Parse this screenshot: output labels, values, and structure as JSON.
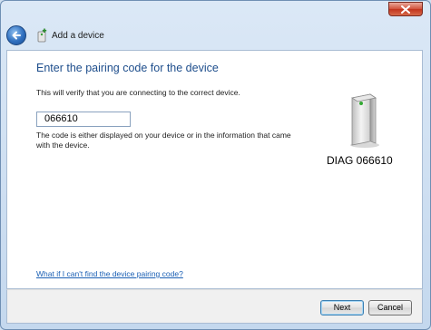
{
  "window": {
    "title": "Add a device",
    "close_icon": "close-icon"
  },
  "content": {
    "heading": "Enter the pairing code for the device",
    "subtext": "This will verify that you are connecting to the correct device.",
    "code_value": "066610",
    "help_text": "The code is either displayed on your device or in the information that came with the device.",
    "device_name": "DIAG 066610",
    "device_icon": "device-tower-icon",
    "help_link": "What if I can't find the device pairing code?"
  },
  "footer": {
    "next_label": "Next",
    "cancel_label": "Cancel"
  },
  "colors": {
    "heading": "#1e4e8c",
    "link": "#1a5fb4",
    "close": "#c2341e"
  }
}
